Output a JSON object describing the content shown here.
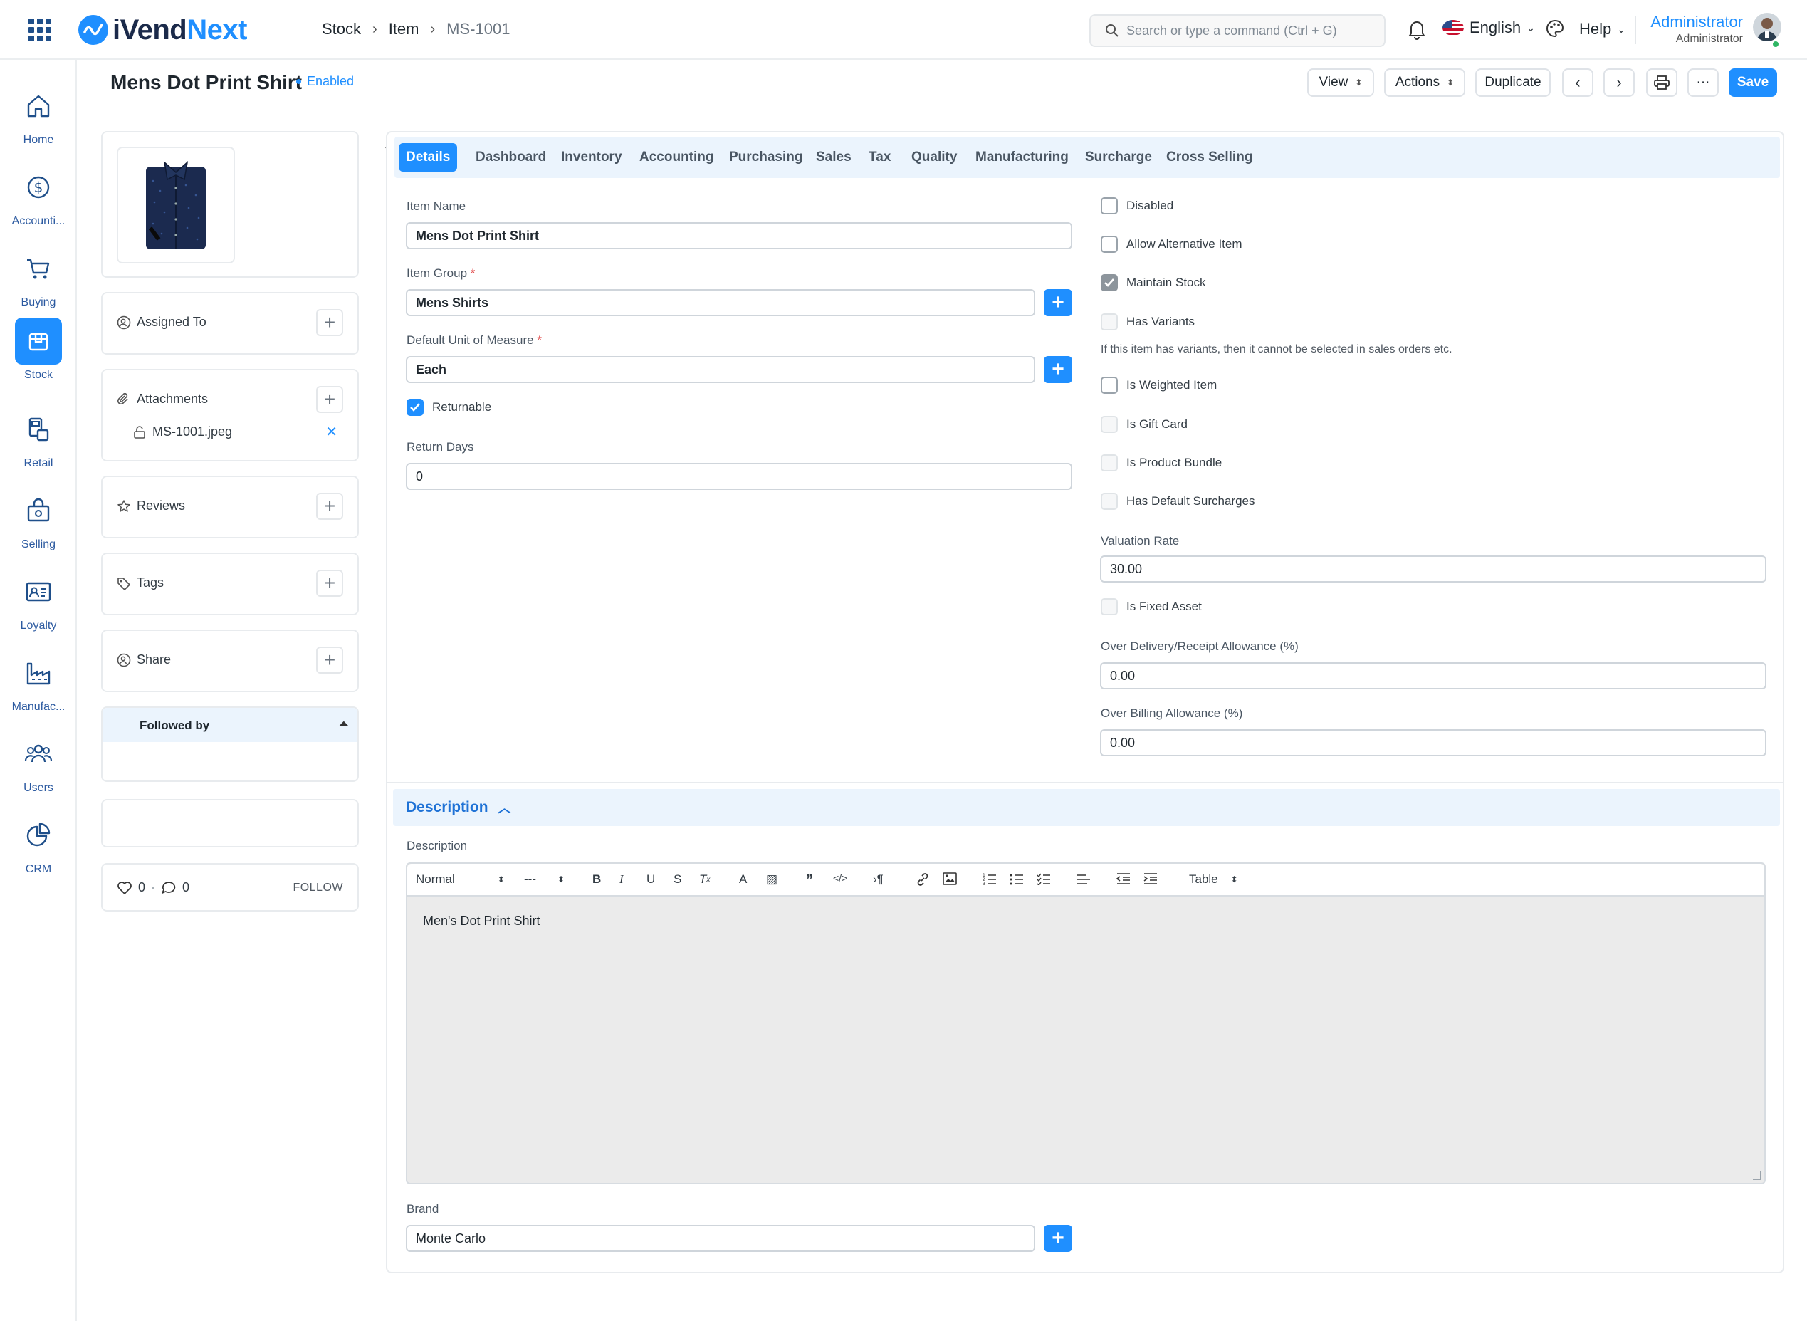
{
  "navbar": {
    "brand_a": "iVend",
    "brand_b": "Next",
    "breadcrumb": [
      "Stock",
      "Item",
      "MS-1001"
    ],
    "search_placeholder": "Search or type a command (Ctrl + G)",
    "language": "English",
    "help": "Help",
    "user_name": "Administrator",
    "user_role": "Administrator"
  },
  "sidebar": {
    "items": [
      {
        "label": "Home",
        "icon": "home-icon"
      },
      {
        "label": "Accounti...",
        "icon": "dollar-icon"
      },
      {
        "label": "Buying",
        "icon": "cart-icon"
      },
      {
        "label": "Stock",
        "icon": "box-icon",
        "active": true
      },
      {
        "label": "Retail",
        "icon": "pos-icon"
      },
      {
        "label": "Selling",
        "icon": "bag-icon"
      },
      {
        "label": "Loyalty",
        "icon": "card-icon"
      },
      {
        "label": "Manufac...",
        "icon": "factory-icon"
      },
      {
        "label": "Users",
        "icon": "users-icon"
      },
      {
        "label": "CRM",
        "icon": "pie-icon"
      }
    ]
  },
  "page": {
    "title": "Mens Dot Print Shirt",
    "status": "Enabled",
    "buttons": {
      "view": "View",
      "actions": "Actions",
      "duplicate": "Duplicate",
      "more": "···",
      "save": "Save"
    }
  },
  "left_panel": {
    "assigned_to": "Assigned To",
    "attachments": "Attachments",
    "attachment_file": "MS-1001.jpeg",
    "reviews": "Reviews",
    "tags": "Tags",
    "share": "Share",
    "followed_by": "Followed by",
    "likes": "0",
    "comments": "0",
    "follow": "FOLLOW"
  },
  "tabs": [
    "Details",
    "Dashboard",
    "Inventory",
    "Accounting",
    "Purchasing",
    "Sales",
    "Tax",
    "Quality",
    "Manufacturing",
    "Surcharge",
    "Cross Selling"
  ],
  "form": {
    "item_name_label": "Item Name",
    "item_name": "Mens Dot Print Shirt",
    "item_group_label": "Item Group",
    "item_group": "Mens Shirts",
    "uom_label": "Default Unit of Measure",
    "uom": "Each",
    "returnable": "Returnable",
    "return_days_label": "Return Days",
    "return_days": "0",
    "disabled": "Disabled",
    "allow_alternative": "Allow Alternative Item",
    "maintain_stock": "Maintain Stock",
    "has_variants": "Has Variants",
    "variants_help": "If this item has variants, then it cannot be selected in sales orders etc.",
    "is_weighted": "Is Weighted Item",
    "is_gift_card": "Is Gift Card",
    "is_product_bundle": "Is Product Bundle",
    "has_default_surcharges": "Has Default Surcharges",
    "valuation_rate_label": "Valuation Rate",
    "valuation_rate": "30.00",
    "is_fixed_asset": "Is Fixed Asset",
    "over_delivery_label": "Over Delivery/Receipt Allowance (%)",
    "over_delivery": "0.00",
    "over_billing_label": "Over Billing Allowance (%)",
    "over_billing": "0.00"
  },
  "description": {
    "section_title": "Description",
    "field_label": "Description",
    "toolbar_style": "Normal",
    "toolbar_size": "---",
    "toolbar_table": "Table",
    "content": "Men's Dot Print Shirt"
  },
  "brand": {
    "label": "Brand",
    "value": "Monte Carlo"
  },
  "colors": {
    "accent": "#1f8fff",
    "tab_bg": "#ebf4fd",
    "brand_dark": "#1b2a4a"
  }
}
